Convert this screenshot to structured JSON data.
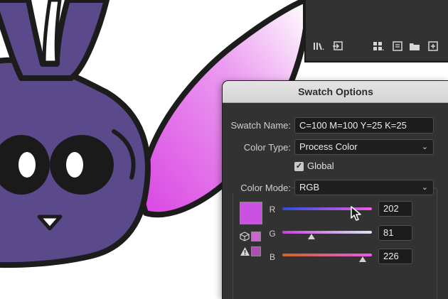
{
  "dialog": {
    "title": "Swatch Options",
    "swatch_name_label": "Swatch Name:",
    "swatch_name_value": "C=100 M=100 Y=25 K=25",
    "color_type_label": "Color Type:",
    "color_type_value": "Process Color",
    "global_label": "Global",
    "global_checked": true,
    "color_mode_label": "Color Mode:",
    "color_mode_value": "RGB",
    "swatch_color": "#ca51e2",
    "sliders": [
      {
        "label": "R",
        "value": "202"
      },
      {
        "label": "G",
        "value": "81"
      },
      {
        "label": "B",
        "value": "226"
      }
    ]
  },
  "swatches_panel": {
    "toolbar_icons": [
      "swatch-libraries-icon",
      "place-swatches-icon",
      "show-swatch-kinds-icon",
      "swatch-options-icon",
      "new-color-group-icon",
      "new-swatch-icon"
    ]
  },
  "colors": {
    "bunny_body": "#5a4a8c",
    "ear_gradient_start": "#e055e6",
    "dialog_bg": "#323232",
    "selected_color": "#ca51e2"
  }
}
